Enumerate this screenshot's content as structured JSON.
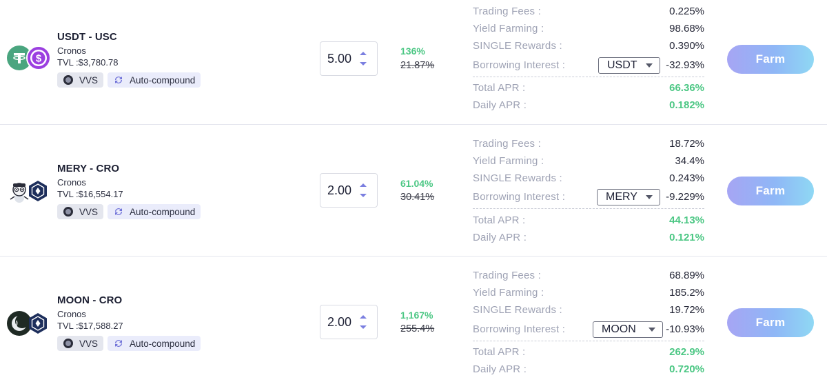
{
  "rows": [
    {
      "pair": "USDT - USC",
      "chain": "Cronos",
      "tvl_label": "TVL :",
      "tvl": "$3,780.78",
      "dex": "VVS",
      "strategy": "Auto-compound",
      "token_a_icon": "tether-icon",
      "token_b_icon": "usc-icon",
      "leverage": "5.00",
      "apr_new": "136%",
      "apr_old": "21.87%",
      "trading_fees_label": "Trading Fees :",
      "trading_fees": "0.225%",
      "yield_farming_label": "Yield Farming :",
      "yield_farming": "98.68%",
      "single_rewards_label": "SINGLE Rewards :",
      "single_rewards": "0.390%",
      "borrowing_label": "Borrowing Interest :",
      "borrow_token": "USDT",
      "borrowing": "-32.93%",
      "total_apr_label": "Total APR :",
      "total_apr": "66.36%",
      "daily_apr_label": "Daily APR :",
      "daily_apr": "0.182%",
      "farm_label": "Farm"
    },
    {
      "pair": "MERY - CRO",
      "chain": "Cronos",
      "tvl_label": "TVL :",
      "tvl": "$16,554.17",
      "dex": "VVS",
      "strategy": "Auto-compound",
      "token_a_icon": "mery-icon",
      "token_b_icon": "cro-icon",
      "leverage": "2.00",
      "apr_new": "61.04%",
      "apr_old": "30.41%",
      "trading_fees_label": "Trading Fees :",
      "trading_fees": "18.72%",
      "yield_farming_label": "Yield Farming :",
      "yield_farming": "34.4%",
      "single_rewards_label": "SINGLE Rewards :",
      "single_rewards": "0.243%",
      "borrowing_label": "Borrowing Interest :",
      "borrow_token": "MERY",
      "borrowing": "-9.229%",
      "total_apr_label": "Total APR :",
      "total_apr": "44.13%",
      "daily_apr_label": "Daily APR :",
      "daily_apr": "0.121%",
      "farm_label": "Farm"
    },
    {
      "pair": "MOON - CRO",
      "chain": "Cronos",
      "tvl_label": "TVL :",
      "tvl": "$17,588.27",
      "dex": "VVS",
      "strategy": "Auto-compound",
      "token_a_icon": "moon-icon",
      "token_b_icon": "cro-icon",
      "leverage": "2.00",
      "apr_new": "1,167%",
      "apr_old": "255.4%",
      "trading_fees_label": "Trading Fees :",
      "trading_fees": "68.89%",
      "yield_farming_label": "Yield Farming :",
      "yield_farming": "185.2%",
      "single_rewards_label": "SINGLE Rewards :",
      "single_rewards": "19.72%",
      "borrowing_label": "Borrowing Interest :",
      "borrow_token": "MOON",
      "borrowing": "-10.93%",
      "total_apr_label": "Total APR :",
      "total_apr": "262.9%",
      "daily_apr_label": "Daily APR :",
      "daily_apr": "0.720%",
      "farm_label": "Farm"
    }
  ],
  "colors": {
    "positive": "#4cc784",
    "label_gray": "#9ea2b4",
    "farm_gradient_start": "#a6a5f4",
    "farm_gradient_end": "#8fd8f4",
    "stepper_arrow": "#7b7fe0"
  }
}
